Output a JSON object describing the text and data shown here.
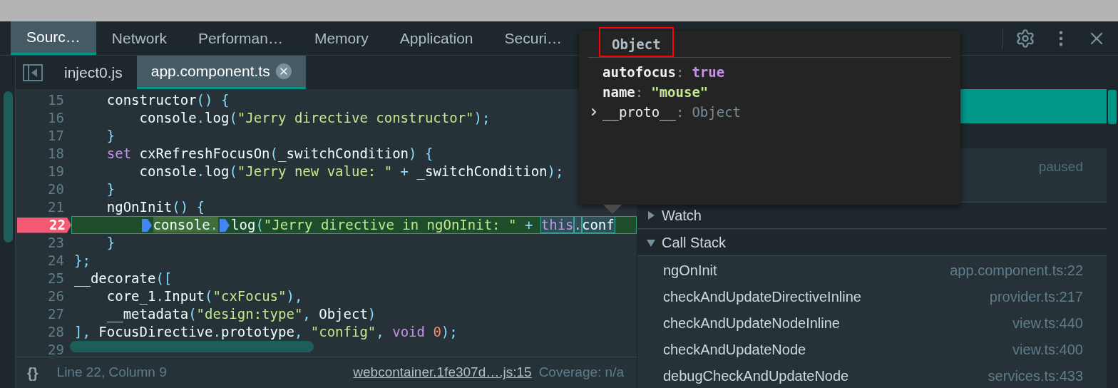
{
  "main_tabs": [
    {
      "label": "Sourc…",
      "selected": true
    },
    {
      "label": "Network",
      "selected": false
    },
    {
      "label": "Performan…",
      "selected": false
    },
    {
      "label": "Memory",
      "selected": false
    },
    {
      "label": "Application",
      "selected": false
    },
    {
      "label": "Securi…",
      "selected": false
    }
  ],
  "file_tabs": [
    {
      "label": "inject0.js",
      "selected": false,
      "closable": false
    },
    {
      "label": "app.component.ts",
      "selected": true,
      "closable": true
    }
  ],
  "code": {
    "lines": [
      {
        "number": "15",
        "breakpoint": false,
        "current": false,
        "tokens": [
          {
            "kind": "id",
            "text": "    constructor"
          },
          {
            "kind": "punct",
            "text": "() {"
          }
        ]
      },
      {
        "number": "16",
        "breakpoint": false,
        "current": false,
        "tokens": [
          {
            "kind": "id",
            "text": "        console"
          },
          {
            "kind": "punct",
            "text": "."
          },
          {
            "kind": "id",
            "text": "log"
          },
          {
            "kind": "punct",
            "text": "("
          },
          {
            "kind": "str",
            "text": "\"Jerry directive constructor\""
          },
          {
            "kind": "punct",
            "text": ");"
          }
        ]
      },
      {
        "number": "17",
        "breakpoint": false,
        "current": false,
        "tokens": [
          {
            "kind": "punct",
            "text": "    }"
          }
        ]
      },
      {
        "number": "18",
        "breakpoint": false,
        "current": false,
        "tokens": [
          {
            "kind": "kw",
            "text": "    set"
          },
          {
            "kind": "id",
            "text": " cxRefreshFocusOn"
          },
          {
            "kind": "punct",
            "text": "("
          },
          {
            "kind": "id",
            "text": "_switchCondition"
          },
          {
            "kind": "punct",
            "text": ") {"
          }
        ]
      },
      {
        "number": "19",
        "breakpoint": false,
        "current": false,
        "tokens": [
          {
            "kind": "id",
            "text": "        console"
          },
          {
            "kind": "punct",
            "text": "."
          },
          {
            "kind": "id",
            "text": "log"
          },
          {
            "kind": "punct",
            "text": "("
          },
          {
            "kind": "str",
            "text": "\"Jerry new value: \""
          },
          {
            "kind": "punct",
            "text": " + "
          },
          {
            "kind": "id",
            "text": "_switchCondition"
          },
          {
            "kind": "punct",
            "text": ");"
          }
        ]
      },
      {
        "number": "20",
        "breakpoint": false,
        "current": false,
        "tokens": [
          {
            "kind": "punct",
            "text": "    }"
          }
        ]
      },
      {
        "number": "21",
        "breakpoint": false,
        "current": false,
        "tokens": [
          {
            "kind": "id",
            "text": "    ngOnInit"
          },
          {
            "kind": "punct",
            "text": "() {"
          }
        ]
      },
      {
        "number": "22",
        "breakpoint": true,
        "current": true,
        "tokens": [
          {
            "kind": "marker"
          },
          {
            "kind": "id",
            "text": "console",
            "executing": true
          },
          {
            "kind": "punct",
            "text": ".",
            "executing": true
          },
          {
            "kind": "marker"
          },
          {
            "kind": "id",
            "text": "log"
          },
          {
            "kind": "punct",
            "text": "("
          },
          {
            "kind": "str",
            "text": "\"Jerry directive in ngOnInit: \""
          },
          {
            "kind": "punct",
            "text": " + "
          },
          {
            "kind": "kw",
            "text": "this",
            "boxed": true
          },
          {
            "kind": "punct",
            "text": ".",
            "boxed": true
          },
          {
            "kind": "id",
            "text": "conf",
            "boxed": true
          }
        ]
      },
      {
        "number": "23",
        "breakpoint": false,
        "current": false,
        "tokens": [
          {
            "kind": "punct",
            "text": "    }"
          }
        ]
      },
      {
        "number": "24",
        "breakpoint": false,
        "current": false,
        "tokens": [
          {
            "kind": "punct",
            "text": "};"
          }
        ]
      },
      {
        "number": "25",
        "breakpoint": false,
        "current": false,
        "tokens": [
          {
            "kind": "id",
            "text": "__decorate"
          },
          {
            "kind": "punct",
            "text": "(["
          }
        ]
      },
      {
        "number": "26",
        "breakpoint": false,
        "current": false,
        "tokens": [
          {
            "kind": "id",
            "text": "    core_1"
          },
          {
            "kind": "punct",
            "text": "."
          },
          {
            "kind": "id",
            "text": "Input"
          },
          {
            "kind": "punct",
            "text": "("
          },
          {
            "kind": "str",
            "text": "\"cxFocus\""
          },
          {
            "kind": "punct",
            "text": "),"
          }
        ]
      },
      {
        "number": "27",
        "breakpoint": false,
        "current": false,
        "tokens": [
          {
            "kind": "id",
            "text": "    __metadata"
          },
          {
            "kind": "punct",
            "text": "("
          },
          {
            "kind": "str",
            "text": "\"design:type\""
          },
          {
            "kind": "punct",
            "text": ", "
          },
          {
            "kind": "id",
            "text": "Object"
          },
          {
            "kind": "punct",
            "text": ")"
          }
        ]
      },
      {
        "number": "28",
        "breakpoint": false,
        "current": false,
        "tokens": [
          {
            "kind": "punct",
            "text": "], "
          },
          {
            "kind": "id",
            "text": "FocusDirective"
          },
          {
            "kind": "punct",
            "text": "."
          },
          {
            "kind": "id",
            "text": "prototype"
          },
          {
            "kind": "punct",
            "text": ", "
          },
          {
            "kind": "str",
            "text": "\"config\""
          },
          {
            "kind": "punct",
            "text": ", "
          },
          {
            "kind": "kw",
            "text": "void"
          },
          {
            "kind": "num",
            "text": " 0"
          },
          {
            "kind": "punct",
            "text": ");"
          }
        ]
      },
      {
        "number": "29",
        "breakpoint": false,
        "current": false
      }
    ]
  },
  "status_bar": {
    "format_button": "{}",
    "position": "Line 22, Column 9",
    "source_link": "webcontainer.1fe307d….js:15",
    "coverage": "Coverage: n/a"
  },
  "popover": {
    "title": "Object",
    "title_highlighted": true,
    "properties": [
      {
        "name": "autofocus",
        "separator": ":",
        "value": "true",
        "kind": "bool",
        "expandable": false
      },
      {
        "name": "name",
        "separator": ":",
        "value": "\"mouse\"",
        "kind": "string",
        "expandable": false
      },
      {
        "name": "__proto__",
        "separator": ":",
        "value": "Object",
        "kind": "proto",
        "expandable": true
      }
    ]
  },
  "debugger": {
    "status": "paused",
    "sections": [
      {
        "title": "Watch",
        "expanded": false
      },
      {
        "title": "Call Stack",
        "expanded": true,
        "frames": [
          {
            "function": "ngOnInit",
            "location": "app.component.ts:22"
          },
          {
            "function": "checkAndUpdateDirectiveInline",
            "location": "provider.ts:217"
          },
          {
            "function": "checkAndUpdateNodeInline",
            "location": "view.ts:440"
          },
          {
            "function": "checkAndUpdateNode",
            "location": "view.ts:400"
          },
          {
            "function": "debugCheckAndUpdateNode",
            "location": "services.ts:433"
          }
        ]
      }
    ]
  }
}
